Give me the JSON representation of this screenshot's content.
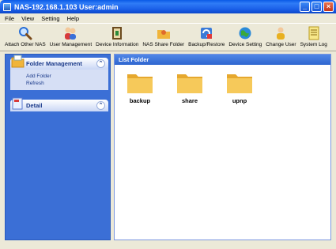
{
  "window": {
    "title": "NAS-192.168.1.103 User:admin"
  },
  "menu": [
    "File",
    "View",
    "Setting",
    "Help"
  ],
  "toolbar": [
    {
      "label": "Attach Other NAS",
      "icon": "search-icon"
    },
    {
      "label": "User Management",
      "icon": "users-icon"
    },
    {
      "label": "Device Information",
      "icon": "device-info-icon"
    },
    {
      "label": "NAS Share Folder",
      "icon": "share-folder-icon"
    },
    {
      "label": "Backup/Restore",
      "icon": "backup-icon"
    },
    {
      "label": "Device Setting",
      "icon": "globe-icon"
    },
    {
      "label": "Change User",
      "icon": "change-user-icon"
    },
    {
      "label": "System Log",
      "icon": "log-icon"
    }
  ],
  "sidebar": {
    "folder_management": {
      "title": "Folder Management",
      "links": [
        "Add Folder",
        "Refresh"
      ]
    },
    "detail": {
      "title": "Detail"
    }
  },
  "main": {
    "header": "List Folder",
    "folders": [
      "backup",
      "share",
      "upnp"
    ]
  },
  "colors": {
    "title_bar": "#1a5ee8",
    "panel_blue": "#3b6fd6",
    "folder": "#f4c24a"
  }
}
